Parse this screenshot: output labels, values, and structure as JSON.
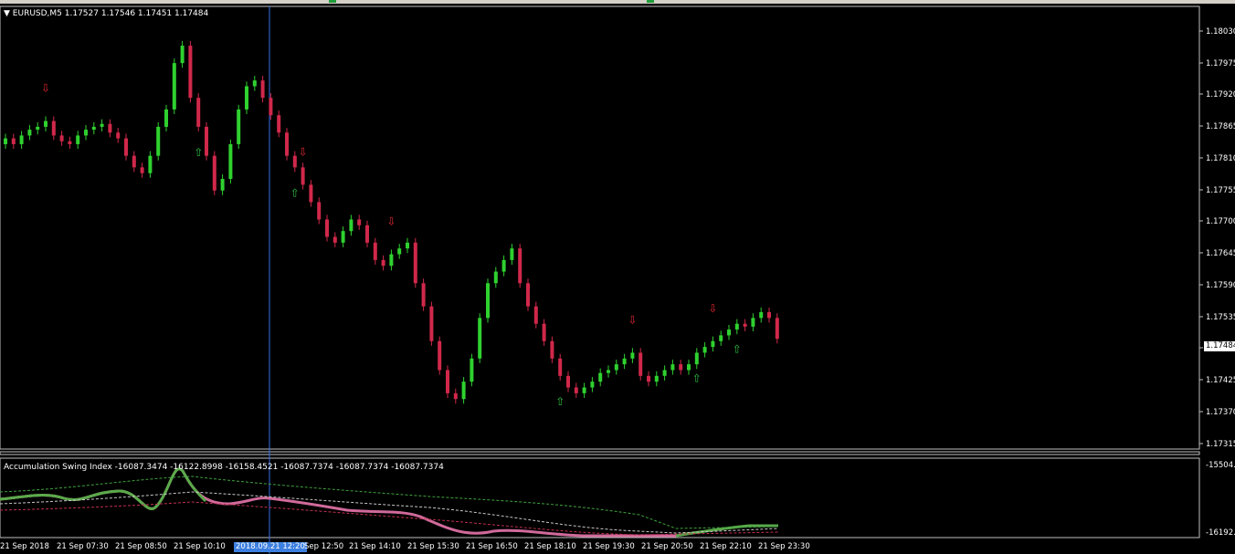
{
  "header": {
    "symbol_line": "EURUSD,M5  1.17527 1.17546 1.17451 1.17484"
  },
  "price_axis": {
    "labels": [
      "1.18030",
      "1.17975",
      "1.17920",
      "1.17865",
      "1.17810",
      "1.17755",
      "1.17700",
      "1.17645",
      "1.17590",
      "1.17535",
      "1.17425",
      "1.17370",
      "1.17315"
    ],
    "current": "1.17484"
  },
  "indicator": {
    "header": "Accumulation Swing Index -16087.3474 -16122.8998 -16158.4521 -16087.7374 -16087.7374 -16087.7374",
    "axis_top": "-15504.2",
    "axis_bottom": "-16192.8"
  },
  "time_axis": {
    "labels": [
      "21 Sep 2018",
      "21 Sep 07:30",
      "21 Sep 08:50",
      "21 Sep 10:10",
      "Sep 12:50",
      "21 Sep 14:10",
      "21 Sep 15:30",
      "21 Sep 16:50",
      "21 Sep 18:10",
      "21 Sep 19:30",
      "21 Sep 20:50",
      "21 Sep 22:10",
      "21 Sep 23:30"
    ],
    "cursor_label": "2018.09.21 12:20"
  },
  "colors": {
    "bull": "#2fd12f",
    "bear": "#d0284a",
    "fractal_up": "#2fbf3f",
    "fractal_down": "#e0282e",
    "asi_main": "#d06a9a",
    "asi_green": "#5aaa4a",
    "cursor": "#3a6ee8"
  },
  "chart_data": {
    "type": "candlestick",
    "closes": [
      1.1783,
      1.1782,
      1.17835,
      1.17845,
      1.1785,
      1.1786,
      1.17835,
      1.17825,
      1.1782,
      1.17835,
      1.17845,
      1.1785,
      1.17855,
      1.1784,
      1.1783,
      1.178,
      1.1778,
      1.1777,
      1.178,
      1.1785,
      1.1788,
      1.1796,
      1.1799,
      1.179,
      1.1785,
      1.178,
      1.1774,
      1.1776,
      1.1782,
      1.1788,
      1.1792,
      1.1793,
      1.179,
      1.1787,
      1.1784,
      1.178,
      1.1778,
      1.1775,
      1.1772,
      1.1769,
      1.1766,
      1.1765,
      1.1767,
      1.1769,
      1.1768,
      1.1765,
      1.1762,
      1.1761,
      1.1763,
      1.1764,
      1.1765,
      1.1758,
      1.1754,
      1.1748,
      1.1743,
      1.1739,
      1.1738,
      1.1741,
      1.1745,
      1.1752,
      1.1758,
      1.176,
      1.1762,
      1.1764,
      1.1758,
      1.1754,
      1.1751,
      1.1748,
      1.1745,
      1.1742,
      1.174,
      1.1739,
      1.174,
      1.1741,
      1.17425,
      1.1743,
      1.1744,
      1.1745,
      1.1746,
      1.1742,
      1.1741,
      1.1742,
      1.1743,
      1.1744,
      1.1743,
      1.1744,
      1.1746,
      1.1747,
      1.1748,
      1.1749,
      1.175,
      1.1751,
      1.17505,
      1.1752,
      1.1753,
      1.1752,
      1.17484
    ],
    "ylim": [
      1.173,
      1.1805
    ],
    "fractals_up_index": [
      24,
      36,
      69,
      86,
      91
    ],
    "fractals_down_index": [
      5,
      37,
      48,
      78,
      88
    ]
  }
}
